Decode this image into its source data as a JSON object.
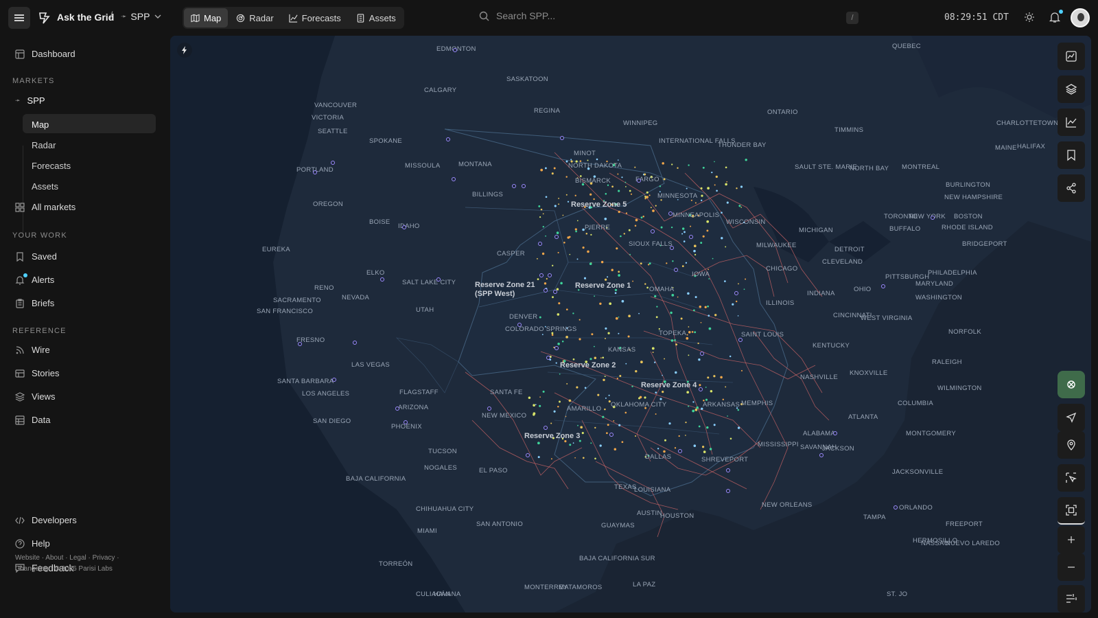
{
  "app": {
    "name": "Ask the Grid",
    "market": "SPP"
  },
  "tabs": [
    {
      "label": "Map",
      "icon": "map-icon",
      "active": true
    },
    {
      "label": "Radar",
      "icon": "radar-icon",
      "active": false
    },
    {
      "label": "Forecasts",
      "icon": "chart-icon",
      "active": false
    },
    {
      "label": "Assets",
      "icon": "assets-icon",
      "active": false
    }
  ],
  "search": {
    "placeholder": "Search SPP...",
    "shortcut": "/"
  },
  "clock": "08:29:51 CDT",
  "sidebar": {
    "dashboard": "Dashboard",
    "markets_heading": "MARKETS",
    "market_name": "SPP",
    "market_items": [
      "Map",
      "Radar",
      "Forecasts",
      "Assets"
    ],
    "all_markets": "All markets",
    "your_work_heading": "YOUR WORK",
    "work_items": [
      "Saved",
      "Alerts",
      "Briefs"
    ],
    "reference_heading": "REFERENCE",
    "reference_items": [
      "Wire",
      "Stories",
      "Views",
      "Data"
    ],
    "developers": "Developers",
    "help": "Help",
    "feedback": "Feedback",
    "footer_line1": "Website · About · Legal · Privacy ·",
    "footer_line2": "Changelog · © 2026 Parisi Labs"
  },
  "map": {
    "zones": [
      "Reserve Zone 5",
      "Reserve Zone 1",
      "Reserve Zone 2",
      "Reserve Zone 4",
      "Reserve Zone 3",
      "Reserve Zone 21 (SPP West)"
    ],
    "cities": [
      "EDMONTON",
      "SASKATOON",
      "CALGARY",
      "VANCOUVER",
      "VICTORIA",
      "REGINA",
      "SEATTLE",
      "SPOKANE",
      "WINNIPEG",
      "QUEBEC",
      "ONTARIO",
      "INTERNATIONAL FALLS",
      "THUNDER BAY",
      "TIMMINS",
      "CHARLOTTETOWN",
      "MONTANA",
      "MISSOULA",
      "PORTLAND",
      "MINOT",
      "NORTH DAKOTA",
      "BISMARCK",
      "FARGO",
      "OREGON",
      "BILLINGS",
      "BOISE",
      "IDAHO",
      "MINNESOTA",
      "MINNEAPOLIS",
      "WISCONSIN",
      "SAULT STE. MARIE",
      "NORTH BAY",
      "MONTREAL",
      "MAINE",
      "HALIFAX",
      "BURLINGTON",
      "NEW HAMPSHIRE",
      "MICHIGAN",
      "TORONTO",
      "NEW YORK",
      "BOSTON",
      "RHODE ISLAND",
      "EUREKA",
      "CASPER",
      "PIERRE",
      "SIOUX FALLS",
      "MILWAUKEE",
      "DETROIT",
      "BUFFALO",
      "BRIDGEPORT",
      "RENO",
      "ELKO",
      "SALT LAKE CITY",
      "CHICAGO",
      "CLEVELAND",
      "PITTSBURGH",
      "PHILADELPHIA",
      "SACRAMENTO",
      "SAN FRANCISCO",
      "NEVADA",
      "UTAH",
      "OMAHA",
      "IOWA",
      "ILLINOIS",
      "INDIANA",
      "OHIO",
      "MARYLAND",
      "WASHINGTON",
      "DENVER",
      "COLORADO SPRINGS",
      "KANSAS",
      "TOPEKA",
      "SAINT LOUIS",
      "CINCINNATI",
      "WEST VIRGINIA",
      "FRESNO",
      "LAS VEGAS",
      "KENTUCKY",
      "NORFOLK",
      "SANTA BARBARA",
      "LOS ANGELES",
      "SANTA FE",
      "NASHVILLE",
      "KNOXVILLE",
      "RALEIGH",
      "FLAGSTAFF",
      "ARIZONA",
      "AMARILLO",
      "OKLAHOMA CITY",
      "ARKANSAS",
      "MEMPHIS",
      "WILMINGTON",
      "SAN DIEGO",
      "PHOENIX",
      "NEW MEXICO",
      "COLUMBIA",
      "ATLANTA",
      "TUCSON",
      "NOGALES",
      "EL PASO",
      "DALLAS",
      "SHREVEPORT",
      "MISSISSIPPI",
      "ALABAMA",
      "SAVANNAH",
      "MONTGOMERY",
      "JACKSON",
      "JACKSONVILLE",
      "BAJA CALIFORNIA",
      "TEXAS",
      "LOUISIANA",
      "AUSTIN",
      "HOUSTON",
      "NEW ORLEANS",
      "ORLANDO",
      "TAMPA",
      "FREEPORT",
      "HERMOSILLO",
      "CHIHUAHUA CITY",
      "SAN ANTONIO",
      "GUAYMAS",
      "MIAMI",
      "NASSAU",
      "NUEVO LAREDO",
      "BAJA CALIFORNIA SUR",
      "TORREÓN",
      "MONTERREY",
      "MATAMOROS",
      "LA PAZ",
      "CULIACÁN",
      "HAVANA",
      "ST. JO"
    ]
  }
}
